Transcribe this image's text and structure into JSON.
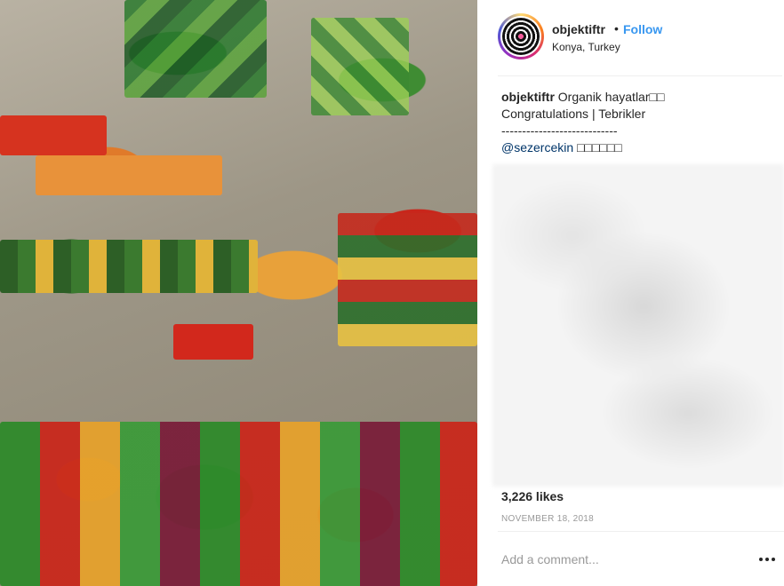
{
  "post": {
    "image_alt": "Aerial view of a colorful produce market"
  },
  "header": {
    "username": "objektiftr",
    "separator": "•",
    "follow_label": "Follow",
    "location": "Konya, Turkey"
  },
  "caption": {
    "username": "objektiftr",
    "line1_text": "Organik hayatlar□□",
    "line2_text": "Congratulations | Tebrikler",
    "line3_text": "----------------------------",
    "mention": "@sezercekin",
    "mention_suffix": "□□□□□□"
  },
  "stats": {
    "likes": "3,226 likes",
    "date": "NOVEMBER 18, 2018"
  },
  "comment": {
    "placeholder": "Add a comment..."
  },
  "icons": {
    "more": "more-options-icon",
    "avatar": "profile-avatar"
  },
  "colors": {
    "link": "#3897f0",
    "text": "#262626",
    "muted": "#999999",
    "divider": "#efefef"
  }
}
